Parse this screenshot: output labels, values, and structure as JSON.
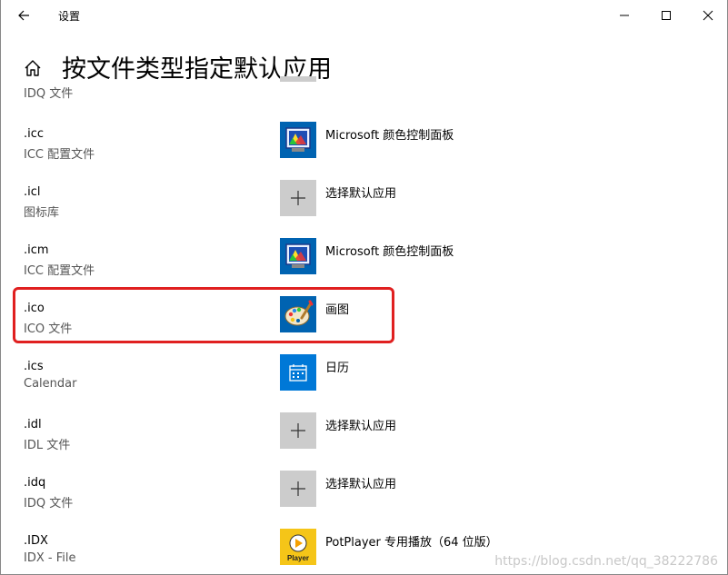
{
  "window": {
    "title": "设置",
    "controls": [
      "minimize-icon",
      "maximize-icon",
      "close-icon"
    ]
  },
  "header": {
    "title": "按文件类型指定默认应用"
  },
  "partial_row": {
    "description": "IDQ 文件"
  },
  "rows": [
    {
      "ext": ".icc",
      "desc": "ICC 配置文件",
      "app": "Microsoft 颜色控制面板",
      "icon": "color-control-panel-icon"
    },
    {
      "ext": ".icl",
      "desc": "图标库",
      "app": "选择默认应用",
      "icon": "plus-icon"
    },
    {
      "ext": ".icm",
      "desc": "ICC 配置文件",
      "app": "Microsoft 颜色控制面板",
      "icon": "color-control-panel-icon"
    },
    {
      "ext": ".ico",
      "desc": "ICO 文件",
      "app": "画图",
      "icon": "paint-icon"
    },
    {
      "ext": ".ics",
      "desc": "Calendar",
      "app": "日历",
      "icon": "calendar-icon"
    },
    {
      "ext": ".idl",
      "desc": "IDL 文件",
      "app": "选择默认应用",
      "icon": "plus-icon"
    },
    {
      "ext": ".idq",
      "desc": "IDQ 文件",
      "app": "选择默认应用",
      "icon": "plus-icon"
    },
    {
      "ext": ".IDX",
      "desc": "IDX - File",
      "app": "PotPlayer 专用播放（64 位版）",
      "icon": "potplayer-icon"
    }
  ],
  "potplayer_tile_text": "Player",
  "watermark": "https://blog.csdn.net/qq_38222786",
  "colors": {
    "highlight_border": "#e02020",
    "tile_blue": "#0063b1",
    "tile_gray": "#cccccc",
    "tile_yellow": "#f5c518"
  }
}
